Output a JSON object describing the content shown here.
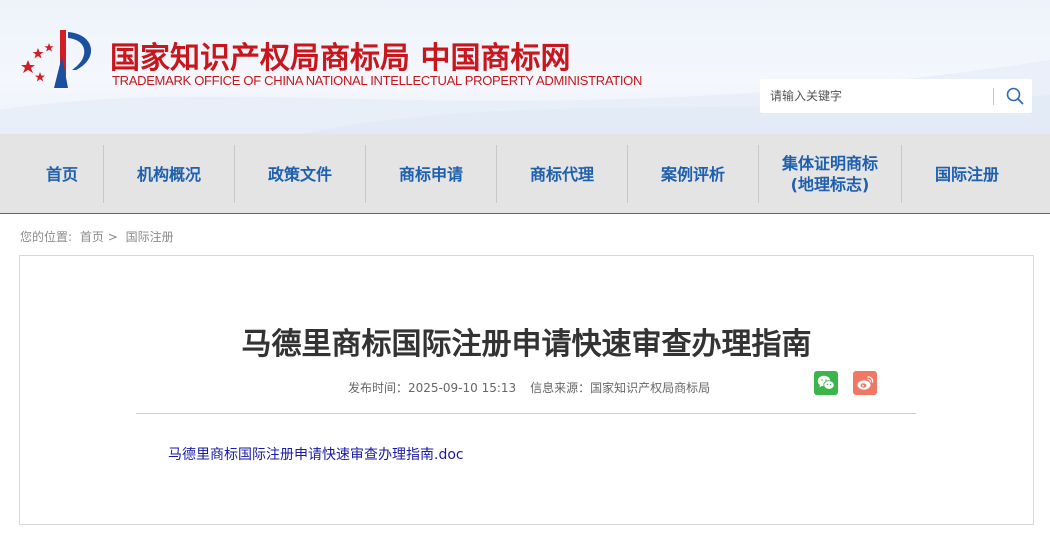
{
  "header": {
    "title": "国家知识产权局商标局 中国商标网",
    "subtitle": "TRADEMARK OFFICE OF CHINA NATIONAL INTELLECTUAL PROPERTY ADMINISTRATION",
    "logo_icon": "cnipa-emblem-icon",
    "brand_color": "#c8161d"
  },
  "search": {
    "placeholder": "请输入关键字",
    "value": "",
    "icon": "search-icon"
  },
  "nav": {
    "accent_color": "#1e5fae",
    "items": [
      {
        "label": "首页"
      },
      {
        "label": "机构概况"
      },
      {
        "label": "政策文件"
      },
      {
        "label": "商标申请"
      },
      {
        "label": "商标代理"
      },
      {
        "label": "案例评析"
      },
      {
        "label": "集体证明商标\n(地理标志)"
      },
      {
        "label": "国际注册"
      }
    ]
  },
  "breadcrumb": {
    "prefix": "您的位置:",
    "home": "首页 >",
    "current": "国际注册"
  },
  "article": {
    "title": "马德里商标国际注册申请快速审查办理指南",
    "publish_label": "发布时间：",
    "publish_time": "2025-09-10 15:13",
    "source_label": "信息来源：",
    "source": "国家知识产权局商标局",
    "share_icons": [
      "wechat-icon",
      "weibo-icon"
    ],
    "attachment": "马德里商标国际注册申请快速审查办理指南.doc"
  }
}
